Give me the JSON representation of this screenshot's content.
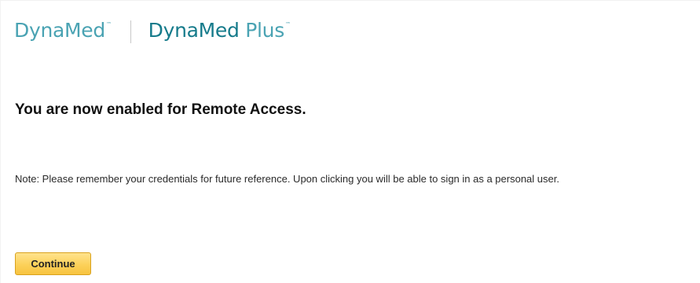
{
  "header": {
    "brand_left": "DynaMed",
    "brand_right_main": "DynaMed",
    "brand_right_plus": "Plus",
    "trademark": "™"
  },
  "main": {
    "headline": "You are now enabled for Remote Access.",
    "note": "Note: Please remember your credentials for future reference. Upon clicking you will be able to sign in as a personal user.",
    "continue_label": "Continue"
  },
  "colors": {
    "brand_light": "#4aa3b3",
    "brand_dark": "#167b8b",
    "button_fill": "#fcd15a",
    "button_border": "#d9a21e"
  }
}
